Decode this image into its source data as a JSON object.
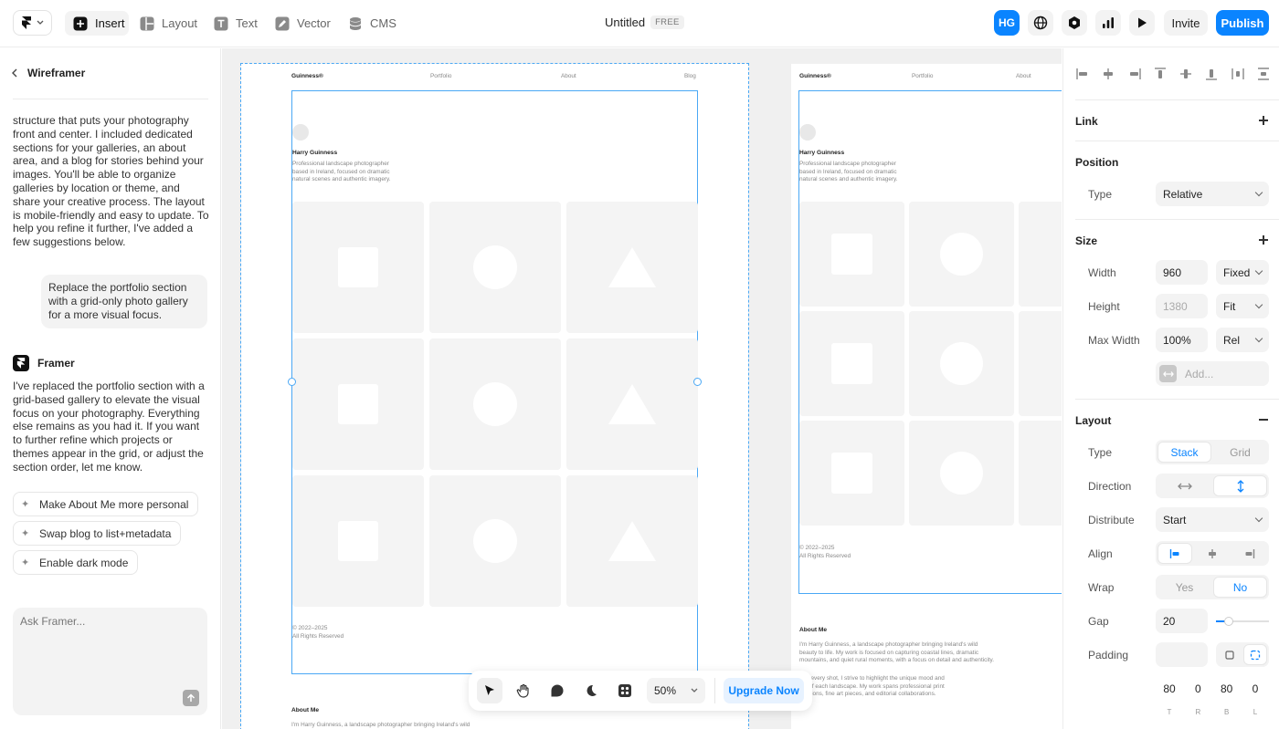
{
  "topbar": {
    "menu_tabs": [
      {
        "label": "Insert",
        "icon": "plus-square-icon",
        "active": true
      },
      {
        "label": "Layout",
        "icon": "layout-icon",
        "active": false
      },
      {
        "label": "Text",
        "icon": "text-icon",
        "active": false
      },
      {
        "label": "Vector",
        "icon": "pen-icon",
        "active": false
      },
      {
        "label": "CMS",
        "icon": "database-icon",
        "active": false
      }
    ],
    "doc_title": "Untitled",
    "plan_badge": "FREE",
    "avatar_initials": "HG",
    "invite_label": "Invite",
    "publish_label": "Publish",
    "accent_color": "#0a84ff"
  },
  "left_panel": {
    "back_title": "Wireframer",
    "assistant_intro": "structure that puts your photography front and center. I included dedicated sections for your galleries, an about area, and a blog for stories behind your images. You'll be able to organize galleries by location or theme, and share your creative process. The layout is mobile-friendly and easy to update. To help you refine it further, I've added a few suggestions below.",
    "user_message": "Replace the portfolio section with a grid-only photo gallery for a more visual focus.",
    "assistant_name": "Framer",
    "assistant_reply": "I've replaced the portfolio section with a grid-based gallery to elevate the visual focus on your photography. Everything else remains as you had it. If you want to further refine which projects or themes appear in the grid, or adjust the section order, let me know.",
    "suggestions": [
      "Make About Me more personal",
      "Swap blog to list+metadata",
      "Enable dark mode"
    ],
    "chat_placeholder": "Ask Framer..."
  },
  "canvas": {
    "site": {
      "logo": "Guinness®",
      "nav": [
        "Portfolio",
        "About",
        "Blog"
      ],
      "name": "Harry Guinness",
      "bio": [
        "Professional landscape photographer",
        "based in Ireland, focused on dramatic",
        "natural scenes and authentic imagery."
      ],
      "footer": [
        "© 2022–2025",
        "All Rights Reserved"
      ],
      "about_heading": "About Me",
      "about_text_main": "I'm Harry Guinness, a landscape photographer bringing Ireland's wild",
      "about_text": [
        "I'm Harry Guinness, a landscape photographer bringing Ireland's wild",
        "beauty to life. My work is focused on capturing coastal lines, dramatic",
        "mountains, and quiet rural moments, with a focus on detail and authenticity."
      ],
      "about_text2": [
        "ugh every shot, I strive to highlight the unique mood and",
        "ing of each landscape. My work spans professional print",
        "missions, fine art pieces, and editorial collaborations."
      ]
    }
  },
  "bottom_toolbar": {
    "tools": [
      "pointer-icon",
      "hand-icon",
      "comment-icon",
      "moon-icon",
      "grid-icon"
    ],
    "zoom": "50%",
    "upgrade_label": "Upgrade Now"
  },
  "right_panel": {
    "link_label": "Link",
    "position": {
      "heading": "Position",
      "type_label": "Type",
      "type_value": "Relative"
    },
    "size": {
      "heading": "Size",
      "width_label": "Width",
      "width_value": "960",
      "width_mode": "Fixed",
      "height_label": "Height",
      "height_value": "1380",
      "height_mode": "Fit",
      "maxwidth_label": "Max Width",
      "maxwidth_value": "100%",
      "maxwidth_mode": "Rel",
      "add_label": "Add..."
    },
    "layout": {
      "heading": "Layout",
      "type_label": "Type",
      "type_options": [
        "Stack",
        "Grid"
      ],
      "direction_label": "Direction",
      "distribute_label": "Distribute",
      "distribute_value": "Start",
      "align_label": "Align",
      "wrap_label": "Wrap",
      "wrap_options": [
        "Yes",
        "No"
      ],
      "gap_label": "Gap",
      "gap_value": "20",
      "padding_label": "Padding",
      "padding_values": [
        "80",
        "0",
        "80",
        "0"
      ],
      "padding_sides": [
        "T",
        "R",
        "B",
        "L"
      ]
    }
  }
}
